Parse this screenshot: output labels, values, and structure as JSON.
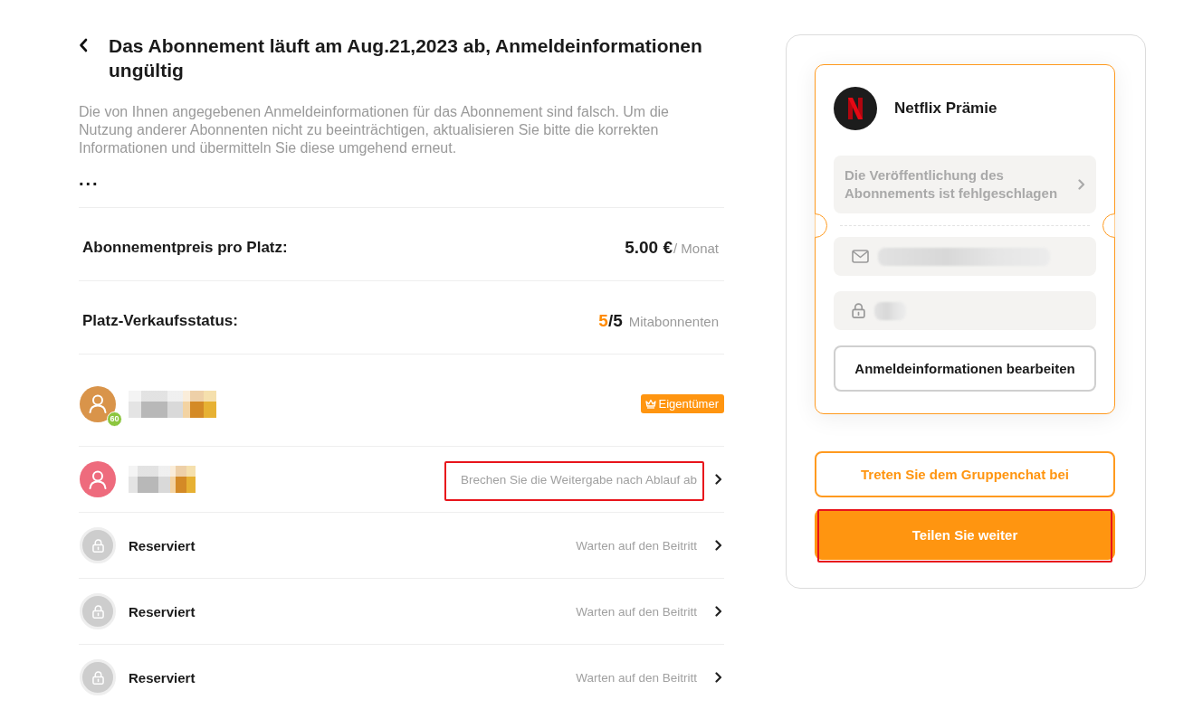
{
  "header": {
    "title": "Das Abonnement läuft am Aug.21,2023 ab, Anmeldeinformationen ungültig",
    "description": "Die von Ihnen angegebenen Anmeldeinformationen für das Abonnement sind falsch. Um die Nutzung anderer Abonnenten nicht zu beeinträchtigen, aktualisieren Sie bitte die korrekten Informationen und übermitteln Sie diese umgehend erneut.",
    "more": "..."
  },
  "summary": [
    {
      "kind": "price",
      "label": "Abonnementpreis pro Platz:",
      "value": "5.00 €",
      "unit": "/ Monat"
    },
    {
      "kind": "seats",
      "label": "Platz-Verkaufsstatus:",
      "sold": "5",
      "total": "/5",
      "unit": "Mitabonnenten"
    }
  ],
  "members": [
    {
      "kind": "member",
      "color": "#d9944a",
      "name_redacted": true,
      "level_badge": "60",
      "owner_badge": "Eigentümer"
    },
    {
      "kind": "member",
      "color": "#ee6b7d",
      "name_redacted": true,
      "action": "Brechen Sie die Weitergabe nach Ablauf ab",
      "highlighted": true
    },
    {
      "kind": "reserved",
      "name": "Reserviert",
      "action": "Warten auf den Beitritt"
    },
    {
      "kind": "reserved",
      "name": "Reserviert",
      "action": "Warten auf den Beitritt"
    },
    {
      "kind": "reserved",
      "name": "Reserviert",
      "action": "Warten auf den Beitritt"
    }
  ],
  "subscription_card": {
    "service": "Netflix Prämie",
    "status_message": "Die Veröffentlichung des Abonnements ist fehlgeschlagen",
    "credentials": [
      {
        "kind": "email",
        "redacted": true
      },
      {
        "kind": "password",
        "redacted": true
      }
    ],
    "edit_button": "Anmeldeinformationen bearbeiten"
  },
  "buttons": [
    {
      "kind": "outline",
      "label": "Treten Sie dem Gruppenchat bei"
    },
    {
      "kind": "primary",
      "label": "Teilen Sie weiter",
      "highlighted": true
    }
  ]
}
